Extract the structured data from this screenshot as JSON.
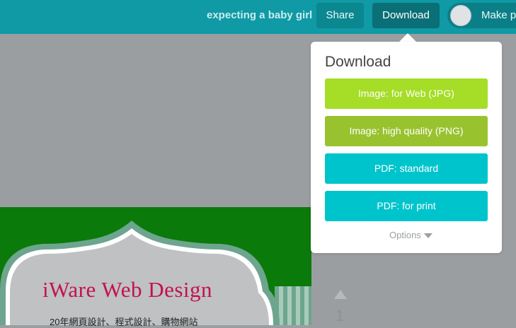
{
  "topbar": {
    "document_title": "expecting a baby girl",
    "share_label": "Share",
    "download_label": "Download",
    "make_public_label": "Make p"
  },
  "canvas": {
    "brand_title": "iWare Web Design",
    "brand_subtitle": "20年網頁設計、程式設計、購物網站",
    "page_number": "1",
    "colors": {
      "green_band": "#0a7a0a",
      "frame": "#6da58f",
      "brand_title": "#c4124b"
    }
  },
  "download_menu": {
    "title": "Download",
    "options": [
      {
        "label": "Image: for Web (JPG)",
        "color": "#a5dd27"
      },
      {
        "label": "Image: high quality (PNG)",
        "color": "#99c22f"
      },
      {
        "label": "PDF: standard",
        "color": "#00c4cc"
      },
      {
        "label": "PDF: for print",
        "color": "#00c4cc"
      }
    ],
    "options_link": "Options",
    "options_icon": "caret-down-icon"
  }
}
